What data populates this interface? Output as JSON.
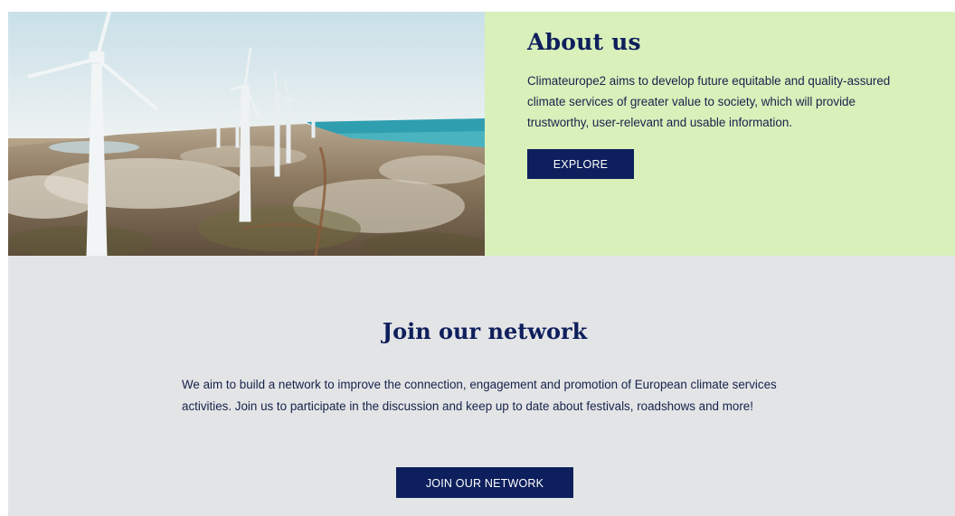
{
  "about": {
    "image_alt": "Wind turbines on a coastal landscape",
    "title": "About us",
    "description": "Climateurope2 aims to develop future equitable and quality-assured climate services of greater value to society, which will provide trustworthy, user-relevant and usable information.",
    "button_label": "EXPLORE"
  },
  "join": {
    "title": "Join our network",
    "description": "We aim to build a network to improve the connection, engagement and promotion of European climate services activities. Join us to participate in the discussion and keep up to date about festivals, roadshows and more!",
    "button_label": "JOIN OUR NETWORK"
  },
  "colors": {
    "navy": "#0d1f5c",
    "about_bg": "#d9f0bb",
    "join_bg": "#e3e4e6"
  }
}
